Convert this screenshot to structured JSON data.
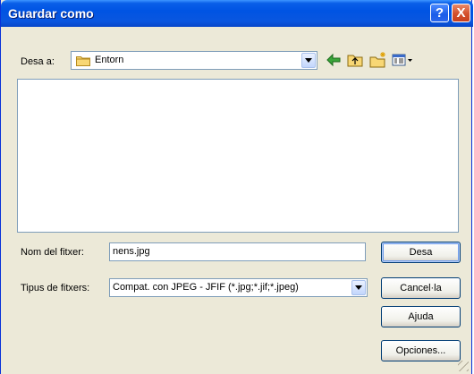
{
  "dialog": {
    "title": "Guardar como",
    "help_symbol": "?",
    "close_symbol": "X"
  },
  "location": {
    "label": "Desa a:",
    "current_folder": "Entorn",
    "folder_icon": "folder-icon"
  },
  "toolbar": {
    "icons": [
      "back-arrow-icon",
      "up-folder-icon",
      "new-folder-icon",
      "view-menu-icon"
    ]
  },
  "filename": {
    "label": "Nom del fitxer:",
    "value": "nens.jpg"
  },
  "filetype": {
    "label": "Tipus de fitxers:",
    "value": "Compat. con JPEG - JFIF (*.jpg;*.jif;*.jpeg)"
  },
  "buttons": {
    "save": "Desa",
    "cancel": "Cancel·la",
    "help": "Ajuda",
    "options": "Opciones..."
  }
}
